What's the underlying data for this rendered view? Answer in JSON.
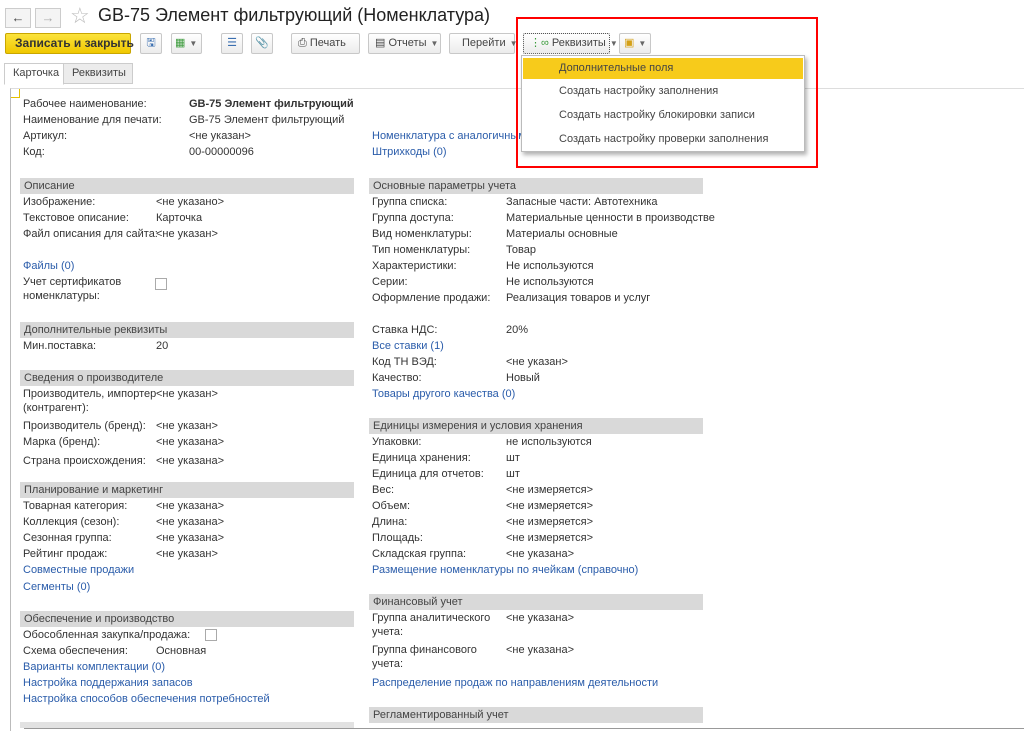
{
  "window": {
    "title": "GB-75 Элемент фильтрующий (Номенклатура)"
  },
  "toolbar": {
    "save_close": "Записать и закрыть",
    "print": "Печать",
    "reports": "Отчеты",
    "goto": "Перейти",
    "requisites": "Реквизиты"
  },
  "tabs": [
    "Карточка",
    "Реквизиты"
  ],
  "requisites_menu": {
    "items": [
      "Дополнительные поля",
      "Создать настройку заполнения",
      "Создать настройку блокировки записи",
      "Создать настройку проверки заполнения"
    ],
    "highlighted": 0,
    "highlight_color": "#f7cb1b"
  },
  "top": {
    "work_name_label": "Рабочее наименование:",
    "work_name": "GB-75 Элемент фильтрующий",
    "print_name_label": "Наименование для печати:",
    "print_name": "GB-75 Элемент фильтрующий",
    "article_label": "Артикул:",
    "article": "<не указан>",
    "code_label": "Код:",
    "code": "00-00000096",
    "analog_link": "Номенклатура с аналогичными",
    "barcodes_link": "Штрихкоды (0)"
  },
  "description": {
    "header": "Описание",
    "image_label": "Изображение:",
    "image": "<не указано>",
    "text_label": "Текстовое описание:",
    "text": "Карточка",
    "site_label": "Файл описания для сайта:",
    "site": "<не указан>",
    "files_link": "Файлы (0)",
    "cert_label_1": "Учет сертификатов",
    "cert_label_2": "номенклатуры:"
  },
  "extra": {
    "header": "Дополнительные реквизиты",
    "min_label": "Мин.поставка:",
    "min": "20"
  },
  "producer": {
    "header": "Сведения о производителе",
    "importer_label_1": "Производитель, импортер",
    "importer_label_2": "(контрагент):",
    "importer": "<не указан>",
    "brand_label": "Производитель (бренд):",
    "brand": "<не указан>",
    "mark_label": "Марка (бренд):",
    "mark": "<не указана>",
    "country_label": "Страна происхождения:",
    "country": "<не указана>"
  },
  "planning": {
    "header": "Планирование и маркетинг",
    "cat_label": "Товарная категория:",
    "cat": "<не указана>",
    "coll_label": "Коллекция (сезон):",
    "coll": "<не указана>",
    "season_label": "Сезонная группа:",
    "season": "<не указана>",
    "rating_label": "Рейтинг продаж:",
    "rating": "<не указан>",
    "joint_link": "Совместные продажи",
    "segments_link": "Сегменты (0)"
  },
  "supply": {
    "header": "Обеспечение и производство",
    "separate_label": "Обособленная закупка/продажа:",
    "scheme_label": "Схема обеспечения:",
    "scheme": "Основная",
    "variants_link": "Варианты комплектации (0)",
    "stock_link": "Настройка поддержания запасов",
    "methods_link": "Настройка способов обеспечения потребностей"
  },
  "main_params": {
    "header": "Основные параметры учета",
    "list_group_label": "Группа списка:",
    "list_group": "Запасные части: Автотехника",
    "access_label": "Группа доступа:",
    "access": "Материальные ценности в производстве",
    "kind_label": "Вид номенклатуры:",
    "kind": "Материалы основные",
    "type_label": "Тип номенклатуры:",
    "type": "Товар",
    "chars_label": "Характеристики:",
    "chars": "Не используются",
    "series_label": "Серии:",
    "series": "Не используются",
    "sale_label": "Оформление продажи:",
    "sale": "Реализация товаров и услуг",
    "vat_label": "Ставка НДС:",
    "vat": "20%",
    "all_rates_link": "Все ставки (1)",
    "tnved_label": "Код ТН ВЭД:",
    "tnved": "<не указан>",
    "quality_label": "Качество:",
    "quality": "Новый",
    "other_quality_link": "Товары другого качества (0)"
  },
  "units": {
    "header": "Единицы измерения и условия хранения",
    "pack_label": "Упаковки:",
    "pack": "не используются",
    "store_label": "Единица хранения:",
    "store": "шт",
    "report_label": "Единица для отчетов:",
    "report": "шт",
    "weight_label": "Вес:",
    "weight": "<не измеряется>",
    "volume_label": "Объем:",
    "volume": "<не измеряется>",
    "length_label": "Длина:",
    "length": "<не измеряется>",
    "area_label": "Площадь:",
    "area": "<не измеряется>",
    "wh_label": "Складская группа:",
    "wh": "<не указана>",
    "placement_link": "Размещение номенклатуры по ячейкам (справочно)"
  },
  "finance": {
    "header": "Финансовый учет",
    "analytic_label_1": "Группа аналитического",
    "analytic_label_2": "учета:",
    "analytic": "<не указана>",
    "fin_label_1": "Группа финансового",
    "fin_label_2": "учета:",
    "fin": "<не указана>",
    "distribution_link": "Распределение продаж по направлениям деятельности"
  },
  "regulated": {
    "header": "Регламентированный учет"
  }
}
